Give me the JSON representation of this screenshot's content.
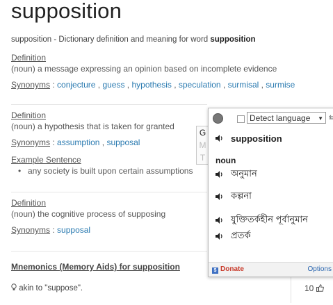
{
  "page": {
    "title": "supposition",
    "subtitle_prefix": "supposition - Dictionary definition and meaning for word ",
    "subtitle_word": "supposition"
  },
  "senses": [
    {
      "heading": "Definition",
      "definition": "(noun) a message expressing an opinion based on incomplete evidence",
      "synonyms_label": "Synonyms",
      "synonyms": [
        "conjecture",
        "guess",
        "hypothesis",
        "speculation",
        "surmisal",
        "surmise"
      ]
    },
    {
      "heading": "Definition",
      "definition": "(noun) a hypothesis that is taken for granted",
      "synonyms_label": "Synonyms",
      "synonyms": [
        "assumption",
        "supposal"
      ],
      "example_heading": "Example Sentence",
      "example": "any society is built upon certain assumptions"
    },
    {
      "heading": "Definition",
      "definition": "(noun) the cognitive process of supposing",
      "synonyms_label": "Synonyms",
      "synonyms": [
        "supposal"
      ]
    }
  ],
  "mnemonics": {
    "heading": "Mnemonics (Memory Aids) for supposition",
    "text": "akin to \"suppose\".",
    "votes": "10"
  },
  "translate_popup": {
    "side_letters": [
      "G",
      "M",
      "T"
    ],
    "language_select": "Detect language",
    "word": "supposition",
    "part_of_speech": "noun",
    "translations": [
      "অনুমান",
      "কল্পনা",
      "যুক্তিতর্কহীন পূর্বানুমান",
      "প্রতর্ক"
    ],
    "donate": "Donate",
    "options": "Options",
    "colors": {
      "donate": "#c83a2a",
      "link": "#2a66b0"
    }
  },
  "colors": {
    "link": "#2a7ab0",
    "text": "#555555"
  }
}
